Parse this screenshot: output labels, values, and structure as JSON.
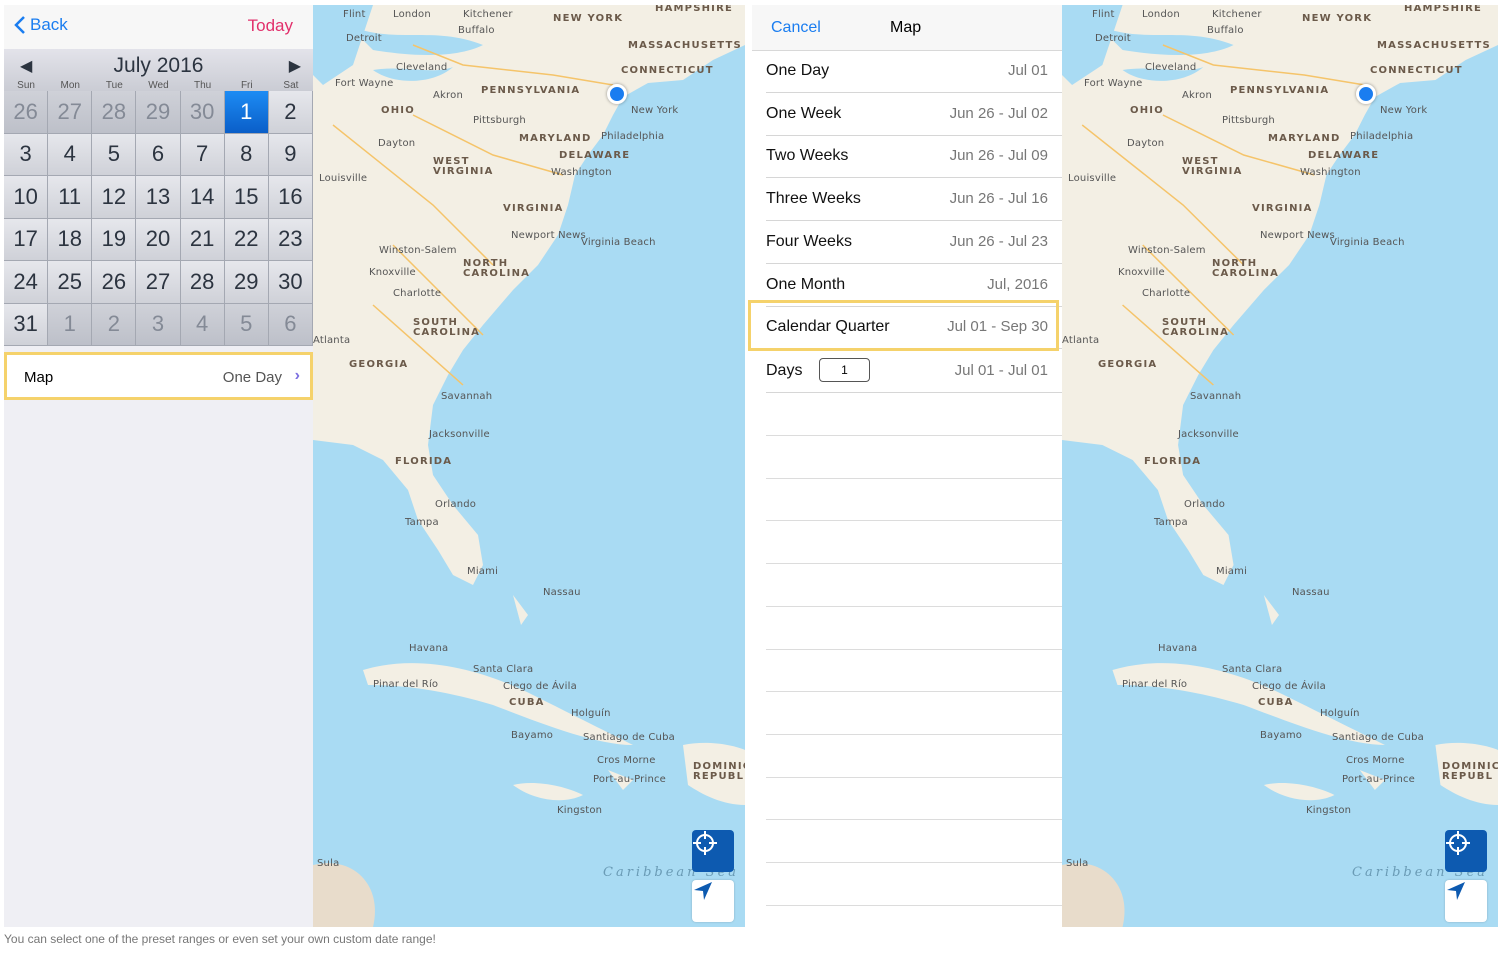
{
  "calendar": {
    "back_label": "Back",
    "today_label": "Today",
    "month_title": "July 2016",
    "weekdays": [
      "Sun",
      "Mon",
      "Tue",
      "Wed",
      "Thu",
      "Fri",
      "Sat"
    ],
    "days": [
      "26",
      "27",
      "28",
      "29",
      "30",
      "1",
      "2",
      "3",
      "4",
      "5",
      "6",
      "7",
      "8",
      "9",
      "10",
      "11",
      "12",
      "13",
      "14",
      "15",
      "16",
      "17",
      "18",
      "19",
      "20",
      "21",
      "22",
      "23",
      "24",
      "25",
      "26",
      "27",
      "28",
      "29",
      "30",
      "31",
      "1",
      "2",
      "3",
      "4",
      "5",
      "6"
    ],
    "selected_day": "1"
  },
  "map_row": {
    "label": "Map",
    "value": "One Day"
  },
  "range_picker": {
    "cancel_label": "Cancel",
    "title": "Map",
    "rows": [
      {
        "label": "One Day",
        "value": "Jul 01"
      },
      {
        "label": "One Week",
        "value": "Jun 26 - Jul 02"
      },
      {
        "label": "Two Weeks",
        "value": "Jun 26 - Jul 09"
      },
      {
        "label": "Three Weeks",
        "value": "Jun 26 - Jul 16"
      },
      {
        "label": "Four Weeks",
        "value": "Jun 26 - Jul 23"
      },
      {
        "label": "One Month",
        "value": "Jul, 2016"
      },
      {
        "label": "Calendar Quarter",
        "value": "Jul 01 - Sep 30"
      }
    ],
    "days_label": "Days",
    "days_value": "1",
    "days_range": "Jul 01 - Jul 01"
  },
  "map": {
    "cities": [
      "Flint",
      "London",
      "Kitchener",
      "Buffalo",
      "Detroit",
      "Cleveland",
      "Fort Wayne",
      "Akron",
      "Pittsburgh",
      "Dayton",
      "Louisville",
      "New York",
      "Philadelphia",
      "Washington",
      "Newport News",
      "Virginia Beach",
      "Winston-Salem",
      "Knoxville",
      "Charlotte",
      "Atlanta",
      "Savannah",
      "Jacksonville",
      "Orlando",
      "Tampa",
      "Miami",
      "Nassau",
      "Havana",
      "Santa Clara",
      "Pinar del Río",
      "Ciego de Ávila",
      "Holguín",
      "Bayamo",
      "Santiago de Cuba",
      "Cros Morne",
      "Port-au-Prince",
      "Kingston",
      "Sula"
    ],
    "states": [
      "NEW YORK",
      "HAMPSHIRE",
      "MASSACHUSETTS",
      "CONNECTICUT",
      "PENNSYLVANIA",
      "OHIO",
      "MARYLAND",
      "DELAWARE",
      "WEST VIRGINIA",
      "VIRGINIA",
      "NORTH CAROLINA",
      "SOUTH CAROLINA",
      "GEORGIA",
      "FLORIDA",
      "CUBA",
      "DOMINIC REPUBL"
    ],
    "sea": "Caribbean Sea",
    "land_color": "#f3efe4",
    "water_color": "#a9dbf3",
    "pin_color": "#1a7df0"
  },
  "caption": "You can select one of the preset ranges or even set your own custom date range!"
}
